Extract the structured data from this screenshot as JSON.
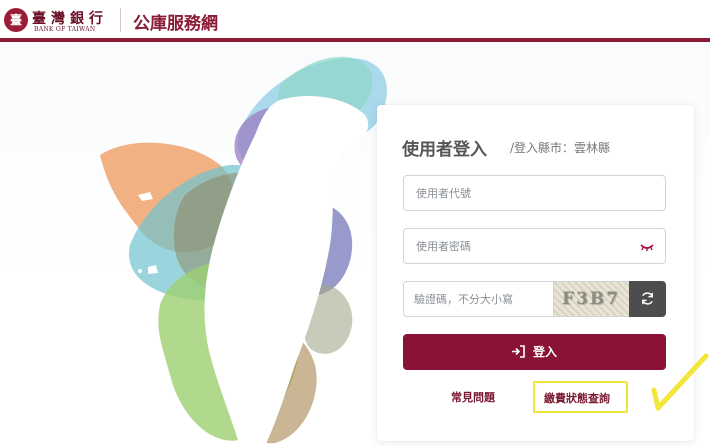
{
  "header": {
    "logo_chinese": "臺灣銀行",
    "logo_english": "BANK OF TAIWAN",
    "site_title": "公庫服務網"
  },
  "login": {
    "title": "使用者登入",
    "subtitle": "/登入縣市：雲林縣",
    "username_placeholder": "使用者代號",
    "password_placeholder": "使用者密碼",
    "captcha_placeholder": "驗證碼，不分大小寫",
    "captcha_code": "F3B7",
    "login_label": "登入",
    "faq_link": "常見問題",
    "payment_status_link": "繳費狀態查詢"
  },
  "icons": {
    "eye": "eye-closed-icon",
    "refresh": "refresh-icon",
    "login": "sign-in-icon"
  },
  "colors": {
    "brand": "#8a1b35",
    "button": "#8a1237",
    "highlight": "#f3e63a"
  }
}
